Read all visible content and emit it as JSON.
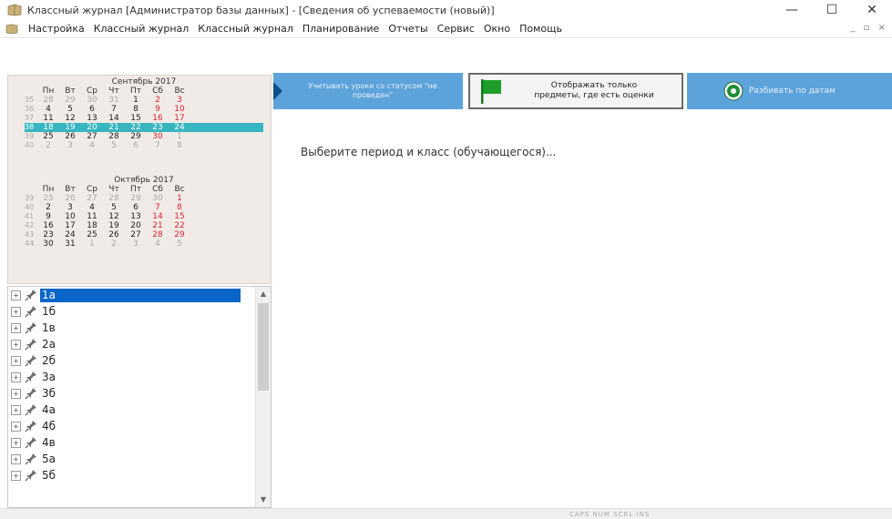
{
  "window": {
    "title": "Классный журнал [Администратор базы данных] - [Сведения об успеваемости (новый)]",
    "minimize_label": "—",
    "maximize_label": "☐",
    "close_label": "✕"
  },
  "menu": {
    "items": [
      "Настройка",
      "Классный журнал",
      "Классный журнал",
      "Планирование",
      "Отчеты",
      "Сервис",
      "Окно",
      "Помощь"
    ],
    "mdi_controls": "_ ▫ ×"
  },
  "calendar": {
    "weekday_headers": [
      "Пн",
      "Вт",
      "Ср",
      "Чт",
      "Пт",
      "Сб",
      "Вс"
    ],
    "months": [
      {
        "name": "Сентябрь 2017",
        "weeks": [
          {
            "num": "35",
            "days": [
              "28",
              "29",
              "30",
              "31",
              "1",
              "2",
              "3"
            ],
            "other": [
              true,
              true,
              true,
              true,
              false,
              false,
              false
            ]
          },
          {
            "num": "36",
            "days": [
              "4",
              "5",
              "6",
              "7",
              "8",
              "9",
              "10"
            ],
            "other": [
              false,
              false,
              false,
              false,
              false,
              false,
              false
            ]
          },
          {
            "num": "37",
            "days": [
              "11",
              "12",
              "13",
              "14",
              "15",
              "16",
              "17"
            ],
            "other": [
              false,
              false,
              false,
              false,
              false,
              false,
              false
            ]
          },
          {
            "num": "38",
            "days": [
              "18",
              "19",
              "20",
              "21",
              "22",
              "23",
              "24"
            ],
            "other": [
              false,
              false,
              false,
              false,
              false,
              false,
              false
            ],
            "selected": true
          },
          {
            "num": "39",
            "days": [
              "25",
              "26",
              "27",
              "28",
              "29",
              "30",
              "1"
            ],
            "other": [
              false,
              false,
              false,
              false,
              false,
              false,
              true
            ]
          },
          {
            "num": "40",
            "days": [
              "2",
              "3",
              "4",
              "5",
              "6",
              "7",
              "8"
            ],
            "other": [
              true,
              true,
              true,
              true,
              true,
              true,
              true
            ]
          }
        ]
      },
      {
        "name": "Октябрь 2017",
        "weeks": [
          {
            "num": "39",
            "days": [
              "25",
              "26",
              "27",
              "28",
              "29",
              "30",
              "1"
            ],
            "other": [
              true,
              true,
              true,
              true,
              true,
              true,
              false
            ]
          },
          {
            "num": "40",
            "days": [
              "2",
              "3",
              "4",
              "5",
              "6",
              "7",
              "8"
            ],
            "other": [
              false,
              false,
              false,
              false,
              false,
              false,
              false
            ]
          },
          {
            "num": "41",
            "days": [
              "9",
              "10",
              "11",
              "12",
              "13",
              "14",
              "15"
            ],
            "other": [
              false,
              false,
              false,
              false,
              false,
              false,
              false
            ]
          },
          {
            "num": "42",
            "days": [
              "16",
              "17",
              "18",
              "19",
              "20",
              "21",
              "22"
            ],
            "other": [
              false,
              false,
              false,
              false,
              false,
              false,
              false
            ]
          },
          {
            "num": "43",
            "days": [
              "23",
              "24",
              "25",
              "26",
              "27",
              "28",
              "29"
            ],
            "other": [
              false,
              false,
              false,
              false,
              false,
              false,
              false
            ]
          },
          {
            "num": "44",
            "days": [
              "30",
              "31",
              "1",
              "2",
              "3",
              "4",
              "5"
            ],
            "other": [
              false,
              false,
              true,
              true,
              true,
              true,
              true
            ]
          }
        ]
      }
    ]
  },
  "tree": {
    "items": [
      {
        "label": "1а",
        "selected": true
      },
      {
        "label": "1б"
      },
      {
        "label": "1в"
      },
      {
        "label": "2а"
      },
      {
        "label": "2б"
      },
      {
        "label": "3а"
      },
      {
        "label": "3б"
      },
      {
        "label": "4а"
      },
      {
        "label": "4б"
      },
      {
        "label": "4в"
      },
      {
        "label": "5а"
      },
      {
        "label": "5б"
      }
    ]
  },
  "toolbar": {
    "count_lessons_label": "Учитывать уроки со статусом \"не проведен\"",
    "show_subjects_label": "Отображать только предметы, где есть оценки",
    "split_by_dates_label": "Разбивать по датам"
  },
  "main": {
    "message": "Выберите период и класс (обучающегося)..."
  },
  "status": {
    "indicators": "CAPS  NUM  SCRL  INS"
  },
  "colors": {
    "toolbar_blue": "#5ca3dc",
    "calendar_selection": "#37b6c0",
    "tree_selection": "#0a65c8",
    "flag_green": "#1e9e2a"
  }
}
